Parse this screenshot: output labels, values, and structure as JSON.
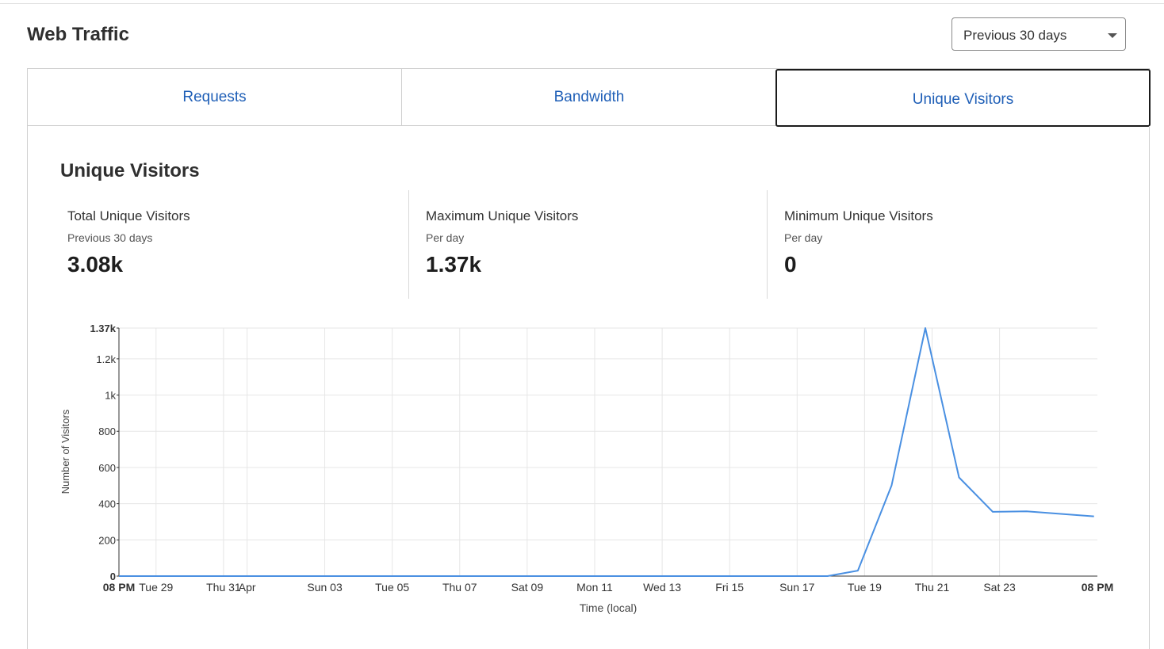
{
  "header": {
    "title": "Web Traffic",
    "range_select": {
      "value": "Previous 30 days"
    }
  },
  "tabs": [
    {
      "label": "Requests",
      "active": false
    },
    {
      "label": "Bandwidth",
      "active": false
    },
    {
      "label": "Unique Visitors",
      "active": true
    }
  ],
  "section": {
    "title": "Unique Visitors",
    "stats": [
      {
        "label": "Total Unique Visitors",
        "sublabel": "Previous 30 days",
        "value": "3.08k"
      },
      {
        "label": "Maximum Unique Visitors",
        "sublabel": "Per day",
        "value": "1.37k"
      },
      {
        "label": "Minimum Unique Visitors",
        "sublabel": "Per day",
        "value": "0"
      }
    ]
  },
  "colors": {
    "accent": "#1f5fb7",
    "line": "#4a90e2",
    "grid": "#e6e6e6"
  },
  "chart_data": {
    "type": "line",
    "title": "",
    "xlabel": "Time (local)",
    "ylabel": "Number of Visitors",
    "ylim": [
      0,
      1370
    ],
    "grid": true,
    "y_ticks": [
      {
        "value": 0,
        "label": "0",
        "bold": true
      },
      {
        "value": 200,
        "label": "200"
      },
      {
        "value": 400,
        "label": "400"
      },
      {
        "value": 600,
        "label": "600"
      },
      {
        "value": 800,
        "label": "800"
      },
      {
        "value": 1000,
        "label": "1k"
      },
      {
        "value": 1200,
        "label": "1.2k"
      },
      {
        "value": 1370,
        "label": "1.37k",
        "bold": true
      }
    ],
    "x_ticks": [
      {
        "day": 0,
        "label": "08 PM",
        "bold": true
      },
      {
        "day": 1.1,
        "label": "Tue 29"
      },
      {
        "day": 3.1,
        "label": "Thu 31"
      },
      {
        "day": 3.8,
        "label": "Apr"
      },
      {
        "day": 6.1,
        "label": "Sun 03"
      },
      {
        "day": 8.1,
        "label": "Tue 05"
      },
      {
        "day": 10.1,
        "label": "Thu 07"
      },
      {
        "day": 12.1,
        "label": "Sat 09"
      },
      {
        "day": 14.1,
        "label": "Mon 11"
      },
      {
        "day": 16.1,
        "label": "Wed 13"
      },
      {
        "day": 18.1,
        "label": "Fri 15"
      },
      {
        "day": 20.1,
        "label": "Sun 17"
      },
      {
        "day": 22.1,
        "label": "Tue 19"
      },
      {
        "day": 24.1,
        "label": "Thu 21"
      },
      {
        "day": 26.1,
        "label": "Sat 23"
      },
      {
        "day": 29,
        "label": "08 PM",
        "bold": true
      }
    ],
    "series": [
      {
        "values": [
          [
            0,
            0
          ],
          [
            1,
            0
          ],
          [
            2,
            0
          ],
          [
            3,
            0
          ],
          [
            4,
            0
          ],
          [
            5,
            0
          ],
          [
            6,
            0
          ],
          [
            7,
            0
          ],
          [
            8,
            0
          ],
          [
            9,
            0
          ],
          [
            10,
            0
          ],
          [
            11,
            0
          ],
          [
            12,
            0
          ],
          [
            13,
            0
          ],
          [
            14,
            0
          ],
          [
            15,
            0
          ],
          [
            16,
            0
          ],
          [
            17,
            0
          ],
          [
            18,
            0
          ],
          [
            19,
            0
          ],
          [
            20,
            0
          ],
          [
            21,
            0
          ],
          [
            21.9,
            30
          ],
          [
            22.9,
            500
          ],
          [
            23.9,
            1370
          ],
          [
            24.9,
            545
          ],
          [
            25.9,
            355
          ],
          [
            26.9,
            358
          ],
          [
            28.9,
            330
          ]
        ]
      }
    ]
  }
}
